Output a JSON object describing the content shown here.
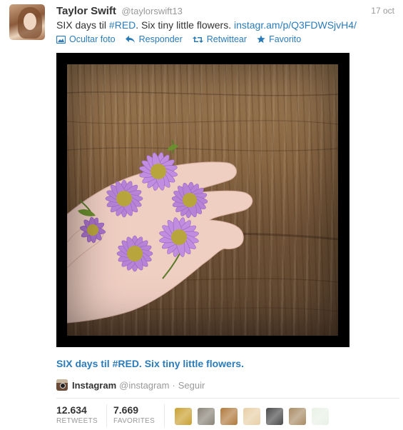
{
  "tweet": {
    "author_name": "Taylor Swift",
    "author_handle": "@taylorswift13",
    "timestamp": "17 oct",
    "text_prefix": "SIX days til ",
    "hashtag": "#RED",
    "text_middle": ". Six tiny little flowers. ",
    "url": "instagr.am/p/Q3FDWSjvH4/"
  },
  "actions": {
    "hide_photo": "Ocultar foto",
    "reply": "Responder",
    "retweet": "Retwittear",
    "favorite": "Favorito"
  },
  "media": {
    "caption": "SIX days til #RED. Six tiny little flowers."
  },
  "source": {
    "name": "Instagram",
    "handle": "@instagram",
    "separator": "·",
    "follow": "Seguir"
  },
  "stats": {
    "retweets_count": "12.634",
    "retweets_label": "RETWEETS",
    "favorites_count": "7.669",
    "favorites_label": "FAVORITES"
  },
  "favoriters": [
    {
      "color": "#c9a030"
    },
    {
      "color": "#8a8478"
    },
    {
      "color": "#b07a3c"
    },
    {
      "color": "#e8cfa6"
    },
    {
      "color": "#4a4a4a"
    },
    {
      "color": "#a98c66"
    },
    {
      "color": "#e9f1e6"
    }
  ],
  "colors": {
    "link": "#2b7bb9",
    "muted": "#999999",
    "text": "#333333",
    "flower_petal": "#b683d6",
    "flower_center": "#b8a53c"
  }
}
